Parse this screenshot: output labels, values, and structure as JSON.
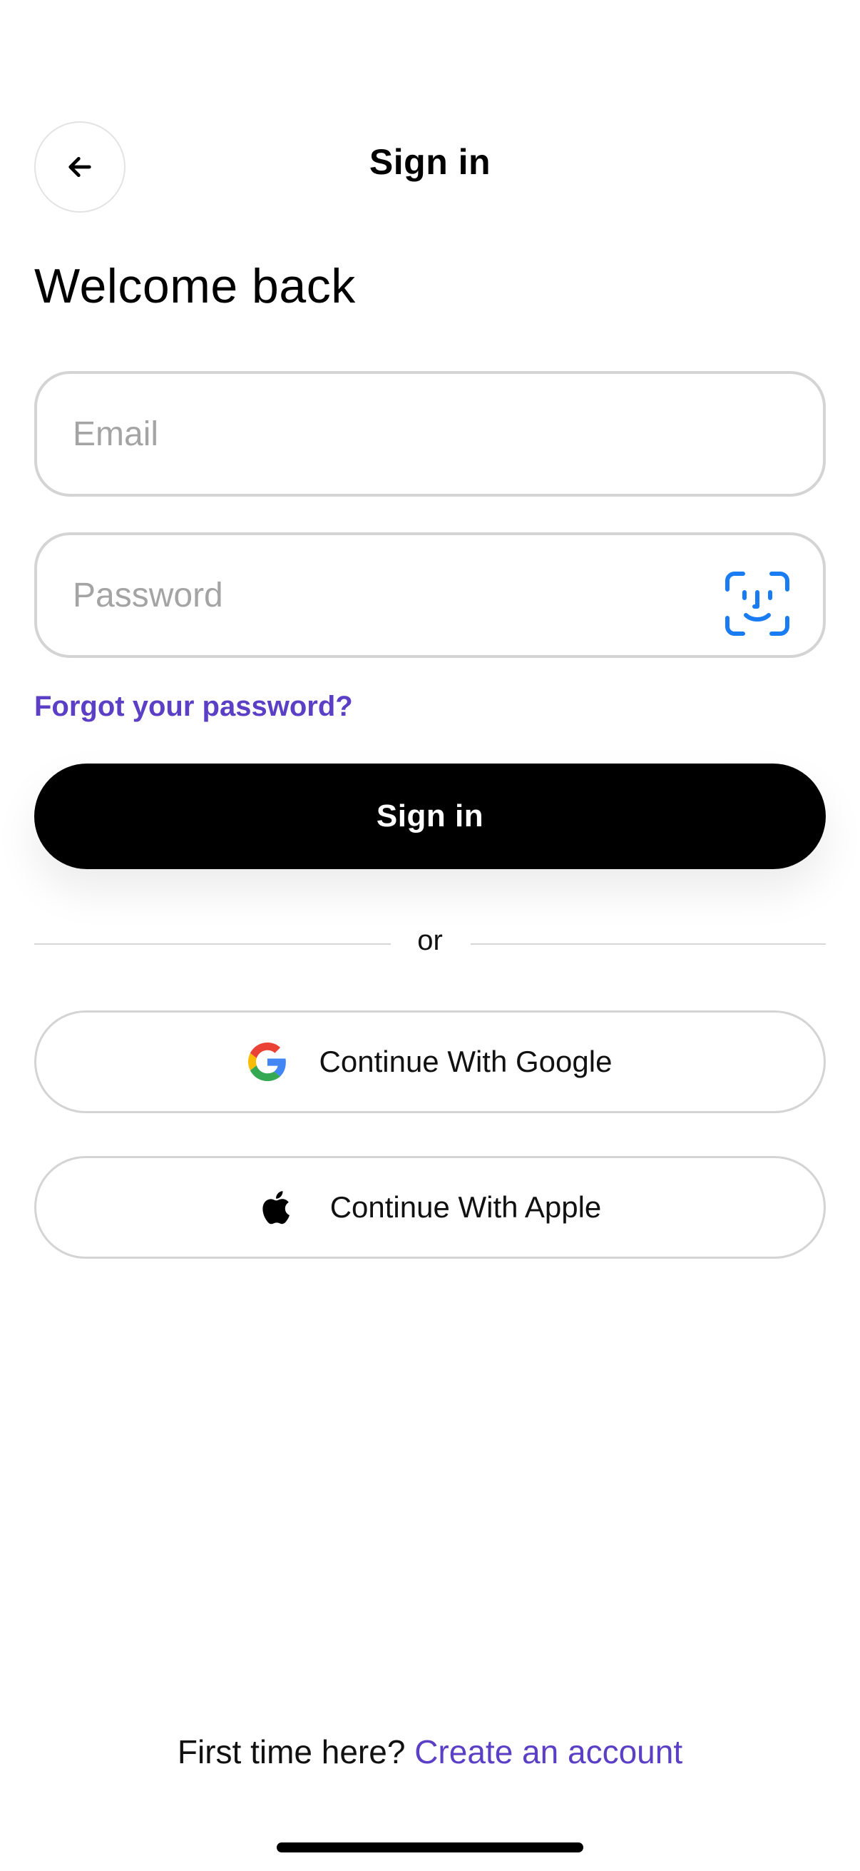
{
  "header": {
    "title": "Sign in"
  },
  "welcome": "Welcome back",
  "form": {
    "email_placeholder": "Email",
    "password_placeholder": "Password",
    "forgot_label": "Forgot your password?",
    "submit_label": "Sign in"
  },
  "divider": "or",
  "social": {
    "google_label": "Continue With Google",
    "apple_label": "Continue With Apple"
  },
  "footer": {
    "prompt": "First time here?",
    "link_label": "Create an account"
  },
  "colors": {
    "accent": "#5b3fc4",
    "primary_button": "#000000",
    "faceid": "#1a7cf2"
  },
  "icons": [
    "back-arrow-icon",
    "face-id-icon",
    "google-icon",
    "apple-icon"
  ]
}
